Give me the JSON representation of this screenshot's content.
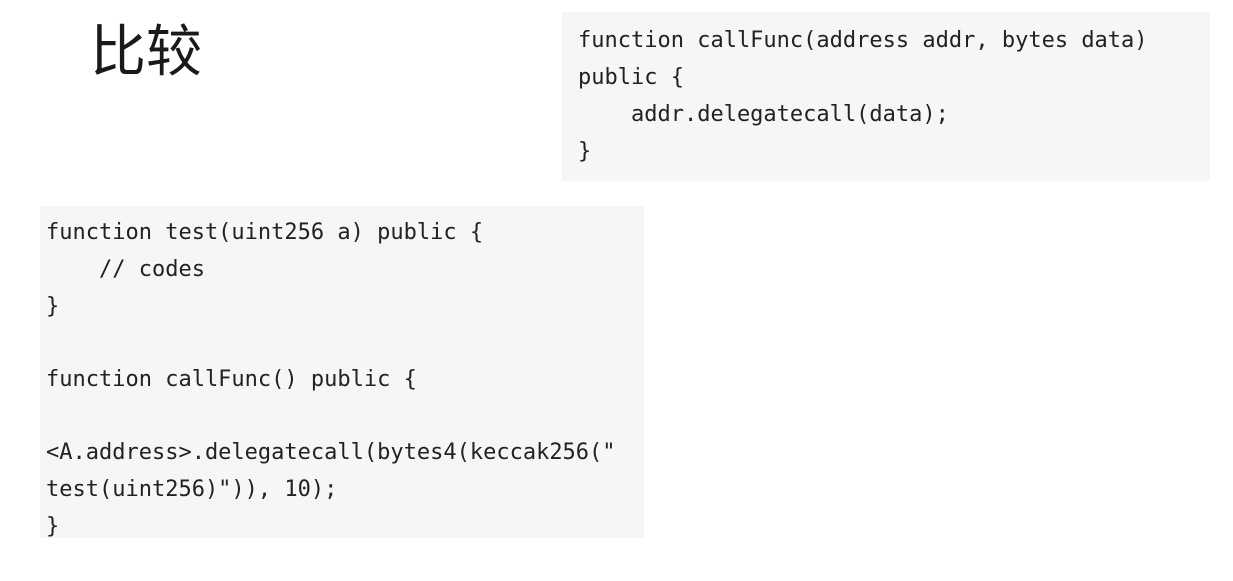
{
  "title": "比较",
  "code_blocks": {
    "top": {
      "lines": [
        "function callFunc(address addr, bytes data)",
        "public {",
        "    addr.delegatecall(data);",
        "}"
      ]
    },
    "bottom": {
      "lines": [
        "function test(uint256 a) public {",
        "    // codes",
        "}",
        "",
        "function callFunc() public {",
        "",
        "<A.address>.delegatecall(bytes4(keccak256(\"",
        "test(uint256)\")), 10);",
        "}"
      ]
    }
  }
}
